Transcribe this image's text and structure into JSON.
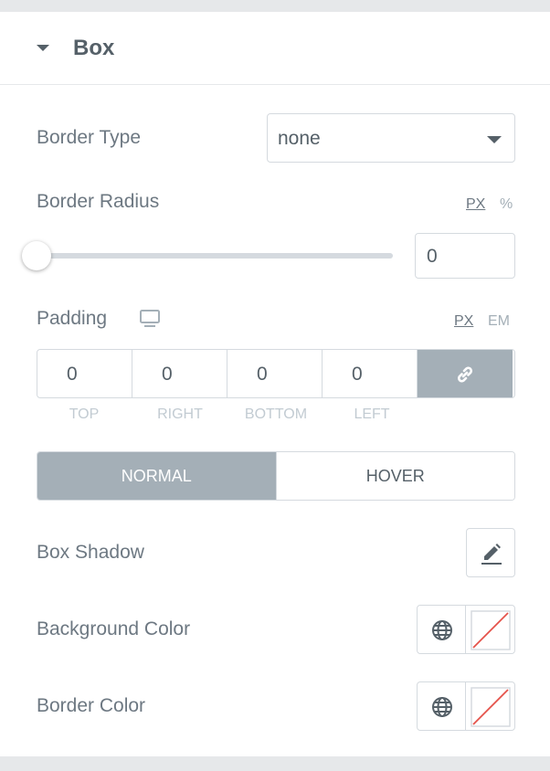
{
  "section": {
    "title": "Box",
    "caret_icon": "caret-down-icon"
  },
  "border_type": {
    "label": "Border Type",
    "value": "none"
  },
  "border_radius": {
    "label": "Border Radius",
    "units": [
      "PX",
      "%"
    ],
    "active_unit": "PX",
    "value": "0",
    "slider_level": 0
  },
  "padding": {
    "label": "Padding",
    "device_icon": "desktop-monitor-icon",
    "units": [
      "PX",
      "EM"
    ],
    "active_unit": "PX",
    "values": [
      "0",
      "0",
      "0",
      "0"
    ],
    "sides": [
      "TOP",
      "RIGHT",
      "BOTTOM",
      "LEFT"
    ],
    "link_icon": "link-icon"
  },
  "state_tabs": {
    "normal": "NORMAL",
    "hover": "HOVER",
    "active": "NORMAL"
  },
  "box_shadow": {
    "label": "Box Shadow",
    "icon": "pencil-edit-icon"
  },
  "background_color": {
    "label": "Background Color",
    "global_icon": "globe-icon",
    "swatch": "no-color-swatch"
  },
  "border_color": {
    "label": "Border Color",
    "global_icon": "globe-icon",
    "swatch": "no-color-swatch"
  },
  "colors": {
    "text": "#556068",
    "label": "#6d7882",
    "border": "#d5dadf",
    "accent": "#a4afb7",
    "muted": "#c2cbd2",
    "swatch_line": "#e5534b"
  }
}
